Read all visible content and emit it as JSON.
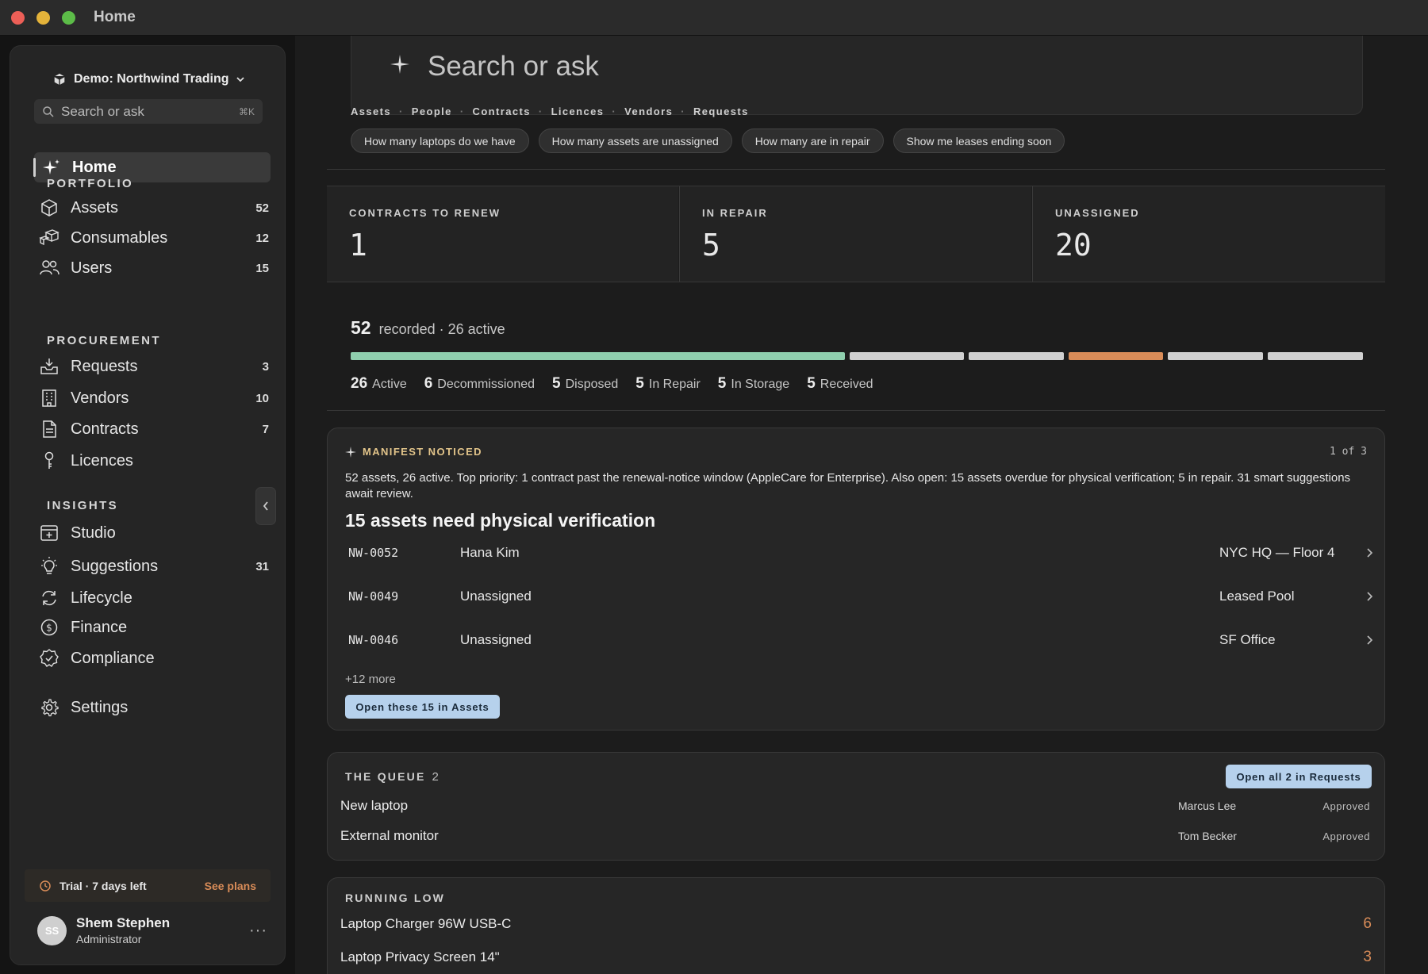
{
  "window": {
    "title": "Home"
  },
  "sidebar": {
    "workspace": "Demo: Northwind Trading",
    "search": {
      "placeholder": "Search or ask",
      "shortcut": "⌘K"
    },
    "home_label": "Home",
    "sections": {
      "portfolio": "PORTFOLIO",
      "procurement": "PROCUREMENT",
      "insights": "INSIGHTS"
    },
    "portfolio_items": [
      {
        "label": "Assets",
        "count": "52",
        "icon": "cube-icon"
      },
      {
        "label": "Consumables",
        "count": "12",
        "icon": "boxes-icon"
      },
      {
        "label": "Users",
        "count": "15",
        "icon": "users-icon"
      }
    ],
    "procurement_items": [
      {
        "label": "Requests",
        "count": "3",
        "icon": "inbox-icon"
      },
      {
        "label": "Vendors",
        "count": "10",
        "icon": "building-icon"
      },
      {
        "label": "Contracts",
        "count": "7",
        "icon": "document-icon"
      },
      {
        "label": "Licences",
        "count": "",
        "icon": "key-icon"
      }
    ],
    "insights_items": [
      {
        "label": "Studio",
        "count": "",
        "icon": "studio-icon"
      },
      {
        "label": "Suggestions",
        "count": "31",
        "icon": "lightbulb-icon"
      },
      {
        "label": "Lifecycle",
        "count": "",
        "icon": "cycle-icon"
      },
      {
        "label": "Finance",
        "count": "",
        "icon": "dollar-icon"
      },
      {
        "label": "Compliance",
        "count": "",
        "icon": "shield-check-icon"
      }
    ],
    "settings_label": "Settings",
    "trial": {
      "text": "Trial · 7 days left",
      "link": "See plans"
    },
    "user": {
      "initials": "SS",
      "name": "Shem Stephen",
      "role": "Administrator"
    }
  },
  "main": {
    "ask_placeholder": "Search or ask",
    "quick_links": [
      "Assets",
      "People",
      "Contracts",
      "Licences",
      "Vendors",
      "Requests"
    ],
    "chips": [
      "How many laptops do we have",
      "How many assets are unassigned",
      "How many are in repair",
      "Show me leases ending soon"
    ],
    "stats": [
      {
        "label": "CONTRACTS TO RENEW",
        "value": "1"
      },
      {
        "label": "IN REPAIR",
        "value": "5"
      },
      {
        "label": "UNASSIGNED",
        "value": "20"
      }
    ],
    "summary": {
      "total": "52",
      "text": "recorded · 26 active"
    },
    "status_bar": [
      {
        "value": 26,
        "color": "#8fcfae"
      },
      {
        "value": 6,
        "color": "#d0d0d0"
      },
      {
        "value": 5,
        "color": "#d0d0d0"
      },
      {
        "value": 5,
        "color": "#d98c58"
      },
      {
        "value": 5,
        "color": "#d0d0d0"
      },
      {
        "value": 5,
        "color": "#d0d0d0"
      }
    ],
    "legend": [
      {
        "n": "26",
        "label": "Active"
      },
      {
        "n": "6",
        "label": "Decommissioned"
      },
      {
        "n": "5",
        "label": "Disposed"
      },
      {
        "n": "5",
        "label": "In Repair"
      },
      {
        "n": "5",
        "label": "In Storage"
      },
      {
        "n": "5",
        "label": "Received"
      }
    ],
    "manifest": {
      "heading": "MANIFEST NOTICED",
      "pager": "1 of 3",
      "text": "52 assets, 26 active. Top priority: 1 contract past the renewal-notice window (AppleCare for Enterprise). Also open: 15 assets overdue for physical verification; 5 in repair. 31 smart suggestions await review.",
      "title": "15 assets need physical verification",
      "rows": [
        {
          "id": "NW-0052",
          "who": "Hana Kim",
          "loc": "NYC HQ — Floor 4"
        },
        {
          "id": "NW-0049",
          "who": "Unassigned",
          "loc": "Leased Pool"
        },
        {
          "id": "NW-0046",
          "who": "Unassigned",
          "loc": "SF Office"
        }
      ],
      "more": "+12 more",
      "button": "Open these 15 in Assets"
    },
    "queue": {
      "heading": "THE QUEUE",
      "count": "2",
      "button": "Open all 2 in Requests",
      "rows": [
        {
          "name": "New laptop",
          "person": "Marcus Lee",
          "status": "Approved"
        },
        {
          "name": "External monitor",
          "person": "Tom Becker",
          "status": "Approved"
        }
      ]
    },
    "running_low": {
      "heading": "RUNNING LOW",
      "rows": [
        {
          "name": "Laptop Charger 96W USB-C",
          "qty": "6"
        },
        {
          "name": "Laptop Privacy Screen 14\"",
          "qty": "3"
        }
      ]
    }
  }
}
